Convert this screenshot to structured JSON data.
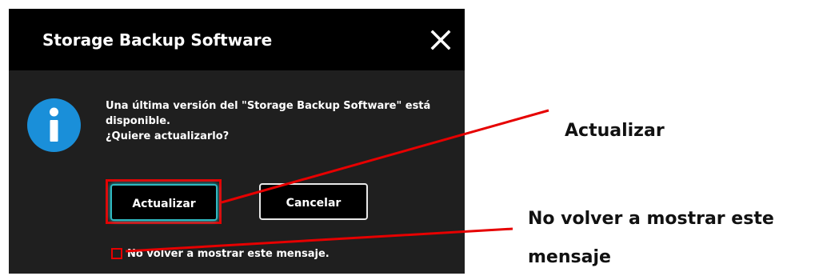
{
  "dialog": {
    "title": "Storage Backup Software",
    "close_icon": "close-icon",
    "info_icon": "info-icon",
    "message_lines": [
      "Una última versión del \"Storage Backup Software\" está",
      "disponible.",
      "¿Quiere actualizarlo?"
    ],
    "buttons": {
      "update_label": "Actualizar",
      "cancel_label": "Cancelar"
    },
    "checkbox": {
      "label": "No volver a mostrar este mensaje.",
      "checked": false
    }
  },
  "callouts": {
    "update": "Actualizar",
    "no_show_line1": "No volver a mostrar este",
    "no_show_line2": "mensaje"
  },
  "colors": {
    "dialog_bg": "#1f1f1f",
    "titlebar_bg": "#000000",
    "info_blue": "#1a8fd9",
    "accent_teal": "#2fb8c0",
    "highlight_red": "#e60000"
  }
}
